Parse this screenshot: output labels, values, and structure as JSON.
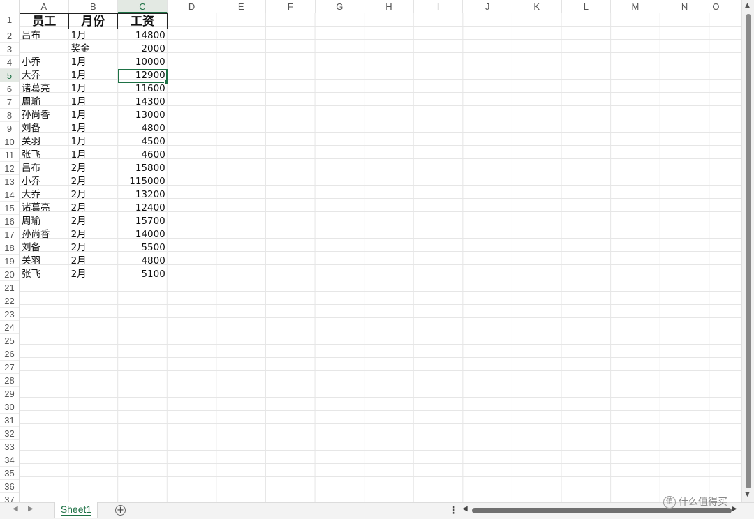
{
  "columns": [
    "A",
    "B",
    "C",
    "D",
    "E",
    "F",
    "G",
    "H",
    "I",
    "J",
    "K",
    "L",
    "M",
    "N",
    "O"
  ],
  "active_column": "C",
  "row_count": 37,
  "active_row": 5,
  "header_row": [
    "员工",
    "月份",
    "工资"
  ],
  "rows": [
    [
      "吕布",
      "1月",
      "14800"
    ],
    [
      "",
      "奖金",
      "2000"
    ],
    [
      "小乔",
      "1月",
      "10000"
    ],
    [
      "大乔",
      "1月",
      "12900"
    ],
    [
      "诸葛亮",
      "1月",
      "11600"
    ],
    [
      "周瑜",
      "1月",
      "14300"
    ],
    [
      "孙尚香",
      "1月",
      "13000"
    ],
    [
      "刘备",
      "1月",
      "4800"
    ],
    [
      "关羽",
      "1月",
      "4500"
    ],
    [
      "张飞",
      "1月",
      "4600"
    ],
    [
      "吕布",
      "2月",
      "15800"
    ],
    [
      "小乔",
      "2月",
      "115000"
    ],
    [
      "大乔",
      "2月",
      "13200"
    ],
    [
      "诸葛亮",
      "2月",
      "12400"
    ],
    [
      "周瑜",
      "2月",
      "15700"
    ],
    [
      "孙尚香",
      "2月",
      "14000"
    ],
    [
      "刘备",
      "2月",
      "5500"
    ],
    [
      "关羽",
      "2月",
      "4800"
    ],
    [
      "张飞",
      "2月",
      "5100"
    ]
  ],
  "sheet_tab": "Sheet1",
  "add_sheet_icon": "plus-circle-icon",
  "watermark": "什么值得买",
  "colors": {
    "accent": "#1e7145",
    "grid": "#e6e6e6"
  }
}
